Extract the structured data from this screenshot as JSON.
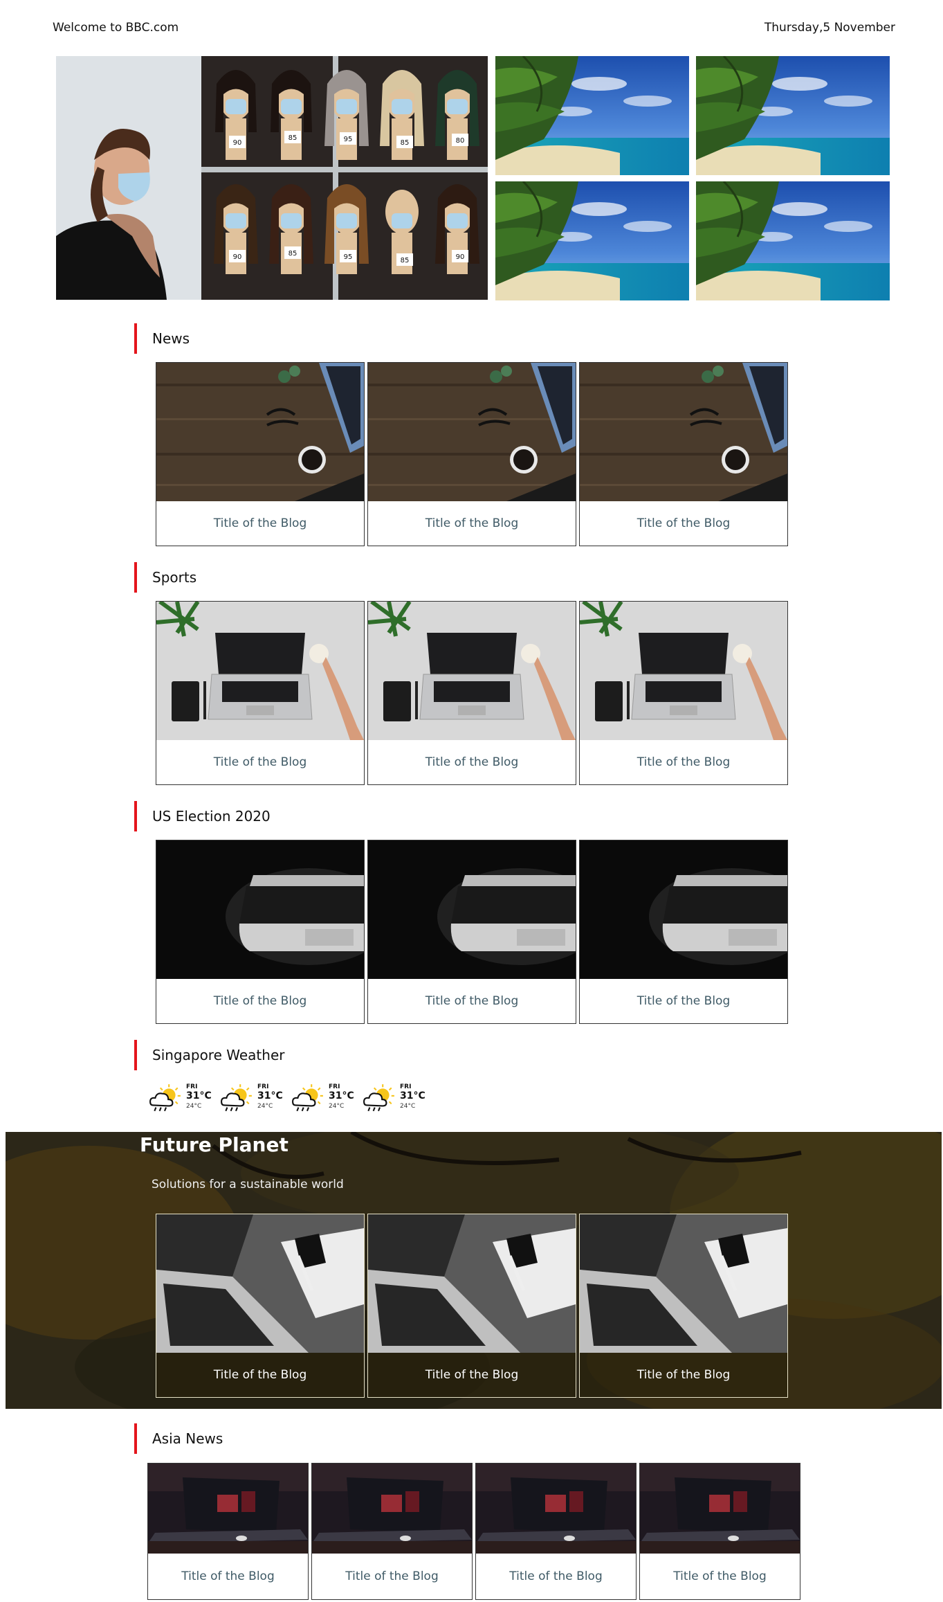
{
  "topbar": {
    "welcome": "Welcome to BBC.com",
    "date": "Thursday,5 November"
  },
  "hero": {
    "price_tags": [
      "90",
      "85",
      "95",
      "85",
      "80",
      "90",
      "85",
      "95",
      "85",
      "90"
    ]
  },
  "sections": [
    {
      "title": "News",
      "cards": [
        "Title of the Blog",
        "Title of the Blog",
        "Title of the Blog"
      ]
    },
    {
      "title": "Sports",
      "cards": [
        "Title of the Blog",
        "Title of the Blog",
        "Title of the Blog"
      ]
    },
    {
      "title": "US Election 2020",
      "cards": [
        "Title of the Blog",
        "Title of the Blog",
        "Title of the Blog"
      ]
    }
  ],
  "weather": {
    "title": "Singapore Weather",
    "days": [
      {
        "day": "FRI",
        "high": "31°C",
        "low": "24°C",
        "icon": "cloud-sun-rain-icon"
      },
      {
        "day": "FRI",
        "high": "31°C",
        "low": "24°C",
        "icon": "cloud-sun-rain-icon"
      },
      {
        "day": "FRI",
        "high": "31°C",
        "low": "24°C",
        "icon": "cloud-sun-rain-icon"
      },
      {
        "day": "FRI",
        "high": "31°C",
        "low": "24°C",
        "icon": "cloud-sun-rain-icon"
      }
    ]
  },
  "future_planet": {
    "title": "Future Planet",
    "subtitle": "Solutions for a sustainable world",
    "cards": [
      "Title of the Blog",
      "Title of the Blog",
      "Title of the Blog"
    ]
  },
  "asia": {
    "title": "Asia News",
    "cards": [
      "Title of the Blog",
      "Title of the Blog",
      "Title of the Blog",
      "Title of the Blog"
    ]
  },
  "colors": {
    "accent": "#e4151c",
    "card_title": "#3f5a66"
  }
}
